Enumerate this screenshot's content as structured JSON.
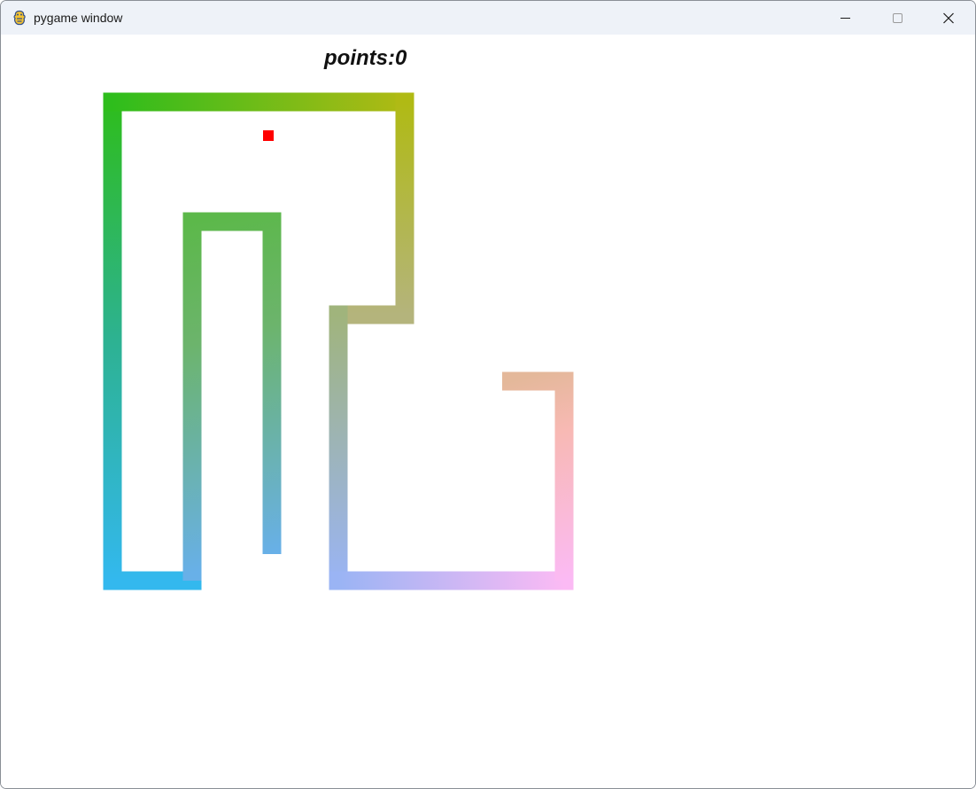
{
  "window": {
    "title": "pygame window",
    "icon": "pygame-snake-icon",
    "controls": {
      "minimize": "minimize-icon",
      "maximize": "maximize-icon",
      "close": "close-icon"
    }
  },
  "game": {
    "score_text": "points:0",
    "colors": {
      "background": "#ffffff",
      "food": "#ff0000",
      "snake_gradient": [
        "#2ebd1c",
        "#b0ba14",
        "#b2b47a",
        "#93a0b0",
        "#a0b4f0",
        "#f7baf5",
        "#f5b896"
      ]
    }
  }
}
